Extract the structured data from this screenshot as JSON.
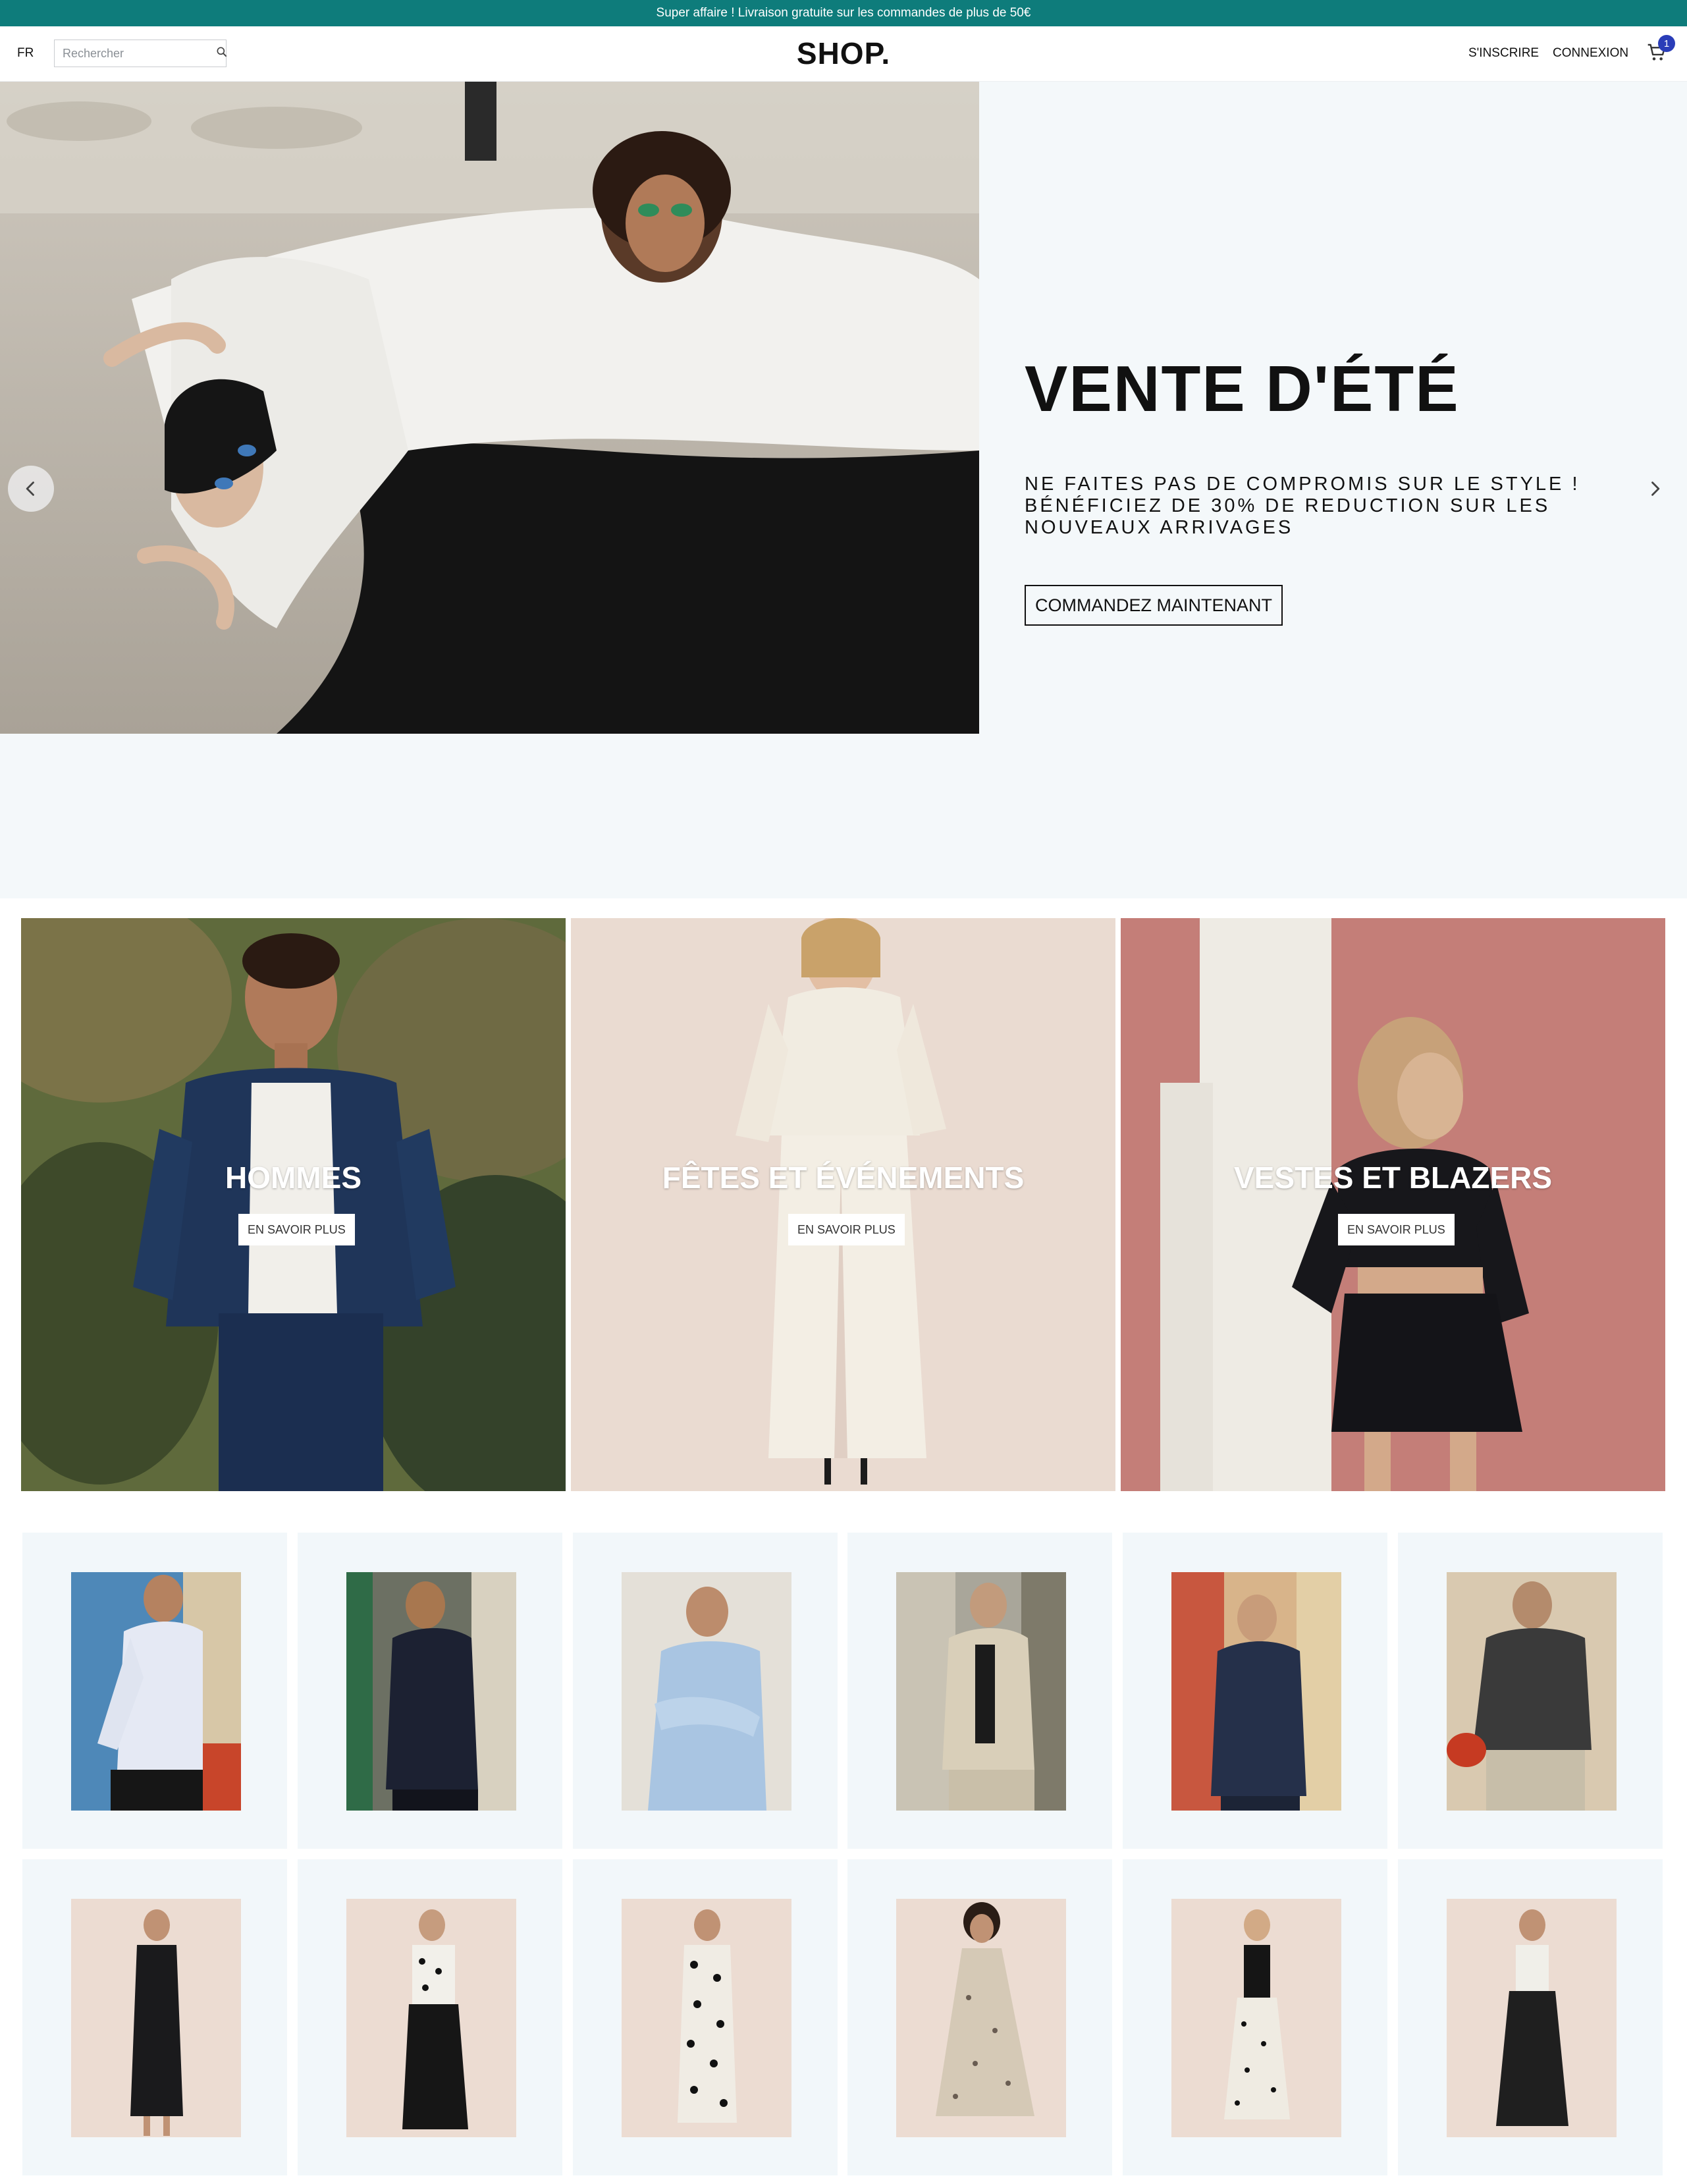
{
  "announcement": "Super affaire ! Livraison gratuite sur les commandes de plus de 50€",
  "header": {
    "language": "FR",
    "search_placeholder": "Rechercher",
    "logo": "SHOP.",
    "signup": "S'INSCRIRE",
    "login": "CONNEXION",
    "cart_count": "1"
  },
  "hero": {
    "title": "VENTE D'ÉTÉ",
    "subtitle_line1": "NE FAITES PAS DE COMPROMIS SUR LE STYLE !",
    "subtitle_line2": "BÉNÉFICIEZ DE 30% DE REDUCTION SUR LES NOUVEAUX ARRIVAGES",
    "cta": "COMMANDEZ MAINTENANT"
  },
  "categories": [
    {
      "title": "HOMMES",
      "button": "EN SAVOIR PLUS"
    },
    {
      "title": "FÊTES ET ÉVÉNEMENTS",
      "button": "EN SAVOIR PLUS"
    },
    {
      "title": "VESTES ET BLAZERS",
      "button": "EN SAVOIR PLUS"
    }
  ],
  "colors": {
    "announcement_bg": "#0e7c7b",
    "cart_badge": "#2a3db8",
    "hero_bg": "#f4f8fa",
    "card_bg": "#f2f7fa"
  },
  "icons": {
    "search": "search-icon",
    "cart": "cart-icon",
    "prev": "chevron-left-icon",
    "next": "chevron-right-icon"
  }
}
